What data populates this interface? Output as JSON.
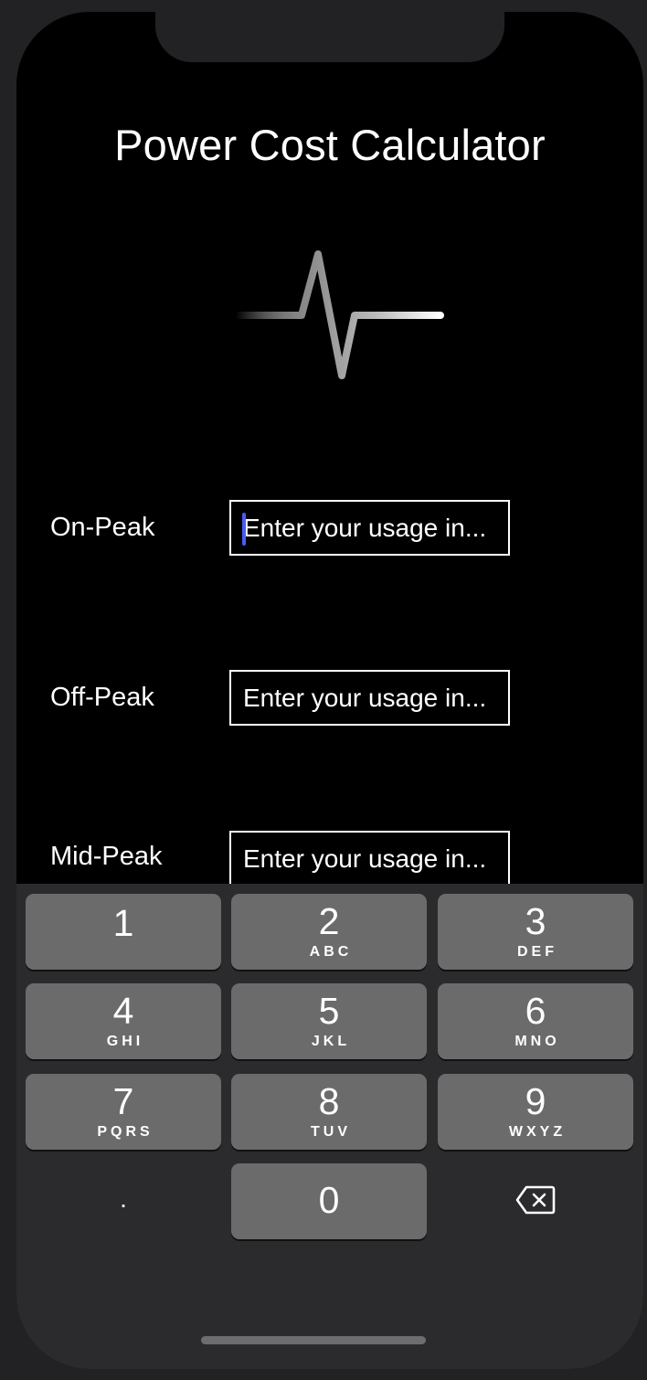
{
  "app": {
    "title": "Power Cost Calculator"
  },
  "fields": [
    {
      "label": "On-Peak",
      "placeholder": "Enter your usage in...",
      "focused": true
    },
    {
      "label": "Off-Peak",
      "placeholder": "Enter your usage in...",
      "focused": false
    },
    {
      "label": "Mid-Peak",
      "placeholder": "Enter your usage in...",
      "focused": false
    }
  ],
  "keyboard": {
    "keys": [
      {
        "num": "1",
        "letters": ""
      },
      {
        "num": "2",
        "letters": "ABC"
      },
      {
        "num": "3",
        "letters": "DEF"
      },
      {
        "num": "4",
        "letters": "GHI"
      },
      {
        "num": "5",
        "letters": "JKL"
      },
      {
        "num": "6",
        "letters": "MNO"
      },
      {
        "num": "7",
        "letters": "PQRS"
      },
      {
        "num": "8",
        "letters": "TUV"
      },
      {
        "num": "9",
        "letters": "WXYZ"
      }
    ],
    "dot": ".",
    "zero": "0",
    "backspace_icon": "backspace-icon"
  },
  "colors": {
    "background": "#000000",
    "caret": "#4a5cf0",
    "key": "#6b6b6b",
    "keyboard_bg": "#2b2b2d"
  },
  "icons": {
    "logo": "pulse-icon"
  }
}
